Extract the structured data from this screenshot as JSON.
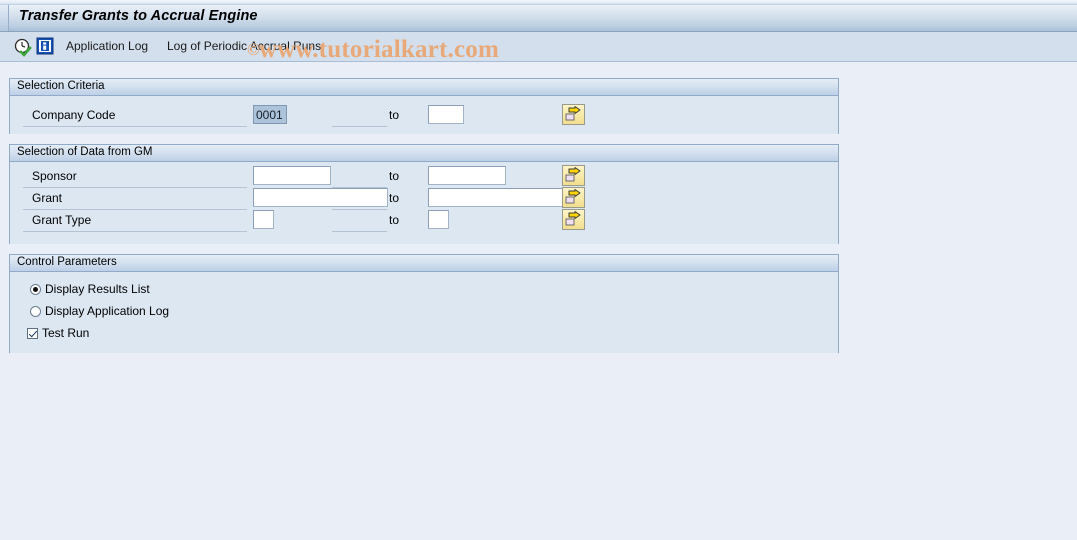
{
  "window": {
    "title": "Transfer Grants to Accrual Engine"
  },
  "toolbar": {
    "execute_icon": "clock-check-icon",
    "info_icon": "info-icon",
    "application_log_label": "Application Log",
    "periodic_log_label": "Log of Periodic Accrual Runs"
  },
  "watermark": {
    "copyright": "©",
    "text": "www.tutorialkart.com",
    "color": "#e8a877"
  },
  "panels": {
    "selection_criteria": {
      "title": "Selection Criteria",
      "rows": [
        {
          "label": "Company Code",
          "from_value": "0001",
          "from_placeholder": "",
          "to_label": "to",
          "to_value": "",
          "to_placeholder": "",
          "multi_select_icon": "multi-select-arrow-icon"
        }
      ]
    },
    "selection_of_data_from_gm": {
      "title": "Selection of Data from GM",
      "rows": [
        {
          "label": "Sponsor",
          "from_value": "",
          "from_placeholder": "",
          "to_label": "to",
          "to_value": "",
          "to_placeholder": "",
          "multi_select_icon": "multi-select-arrow-icon"
        },
        {
          "label": "Grant",
          "from_value": "",
          "from_placeholder": "",
          "to_label": "to",
          "to_value": "",
          "to_placeholder": "",
          "multi_select_icon": "multi-select-arrow-icon"
        },
        {
          "label": "Grant Type",
          "from_value": "",
          "from_placeholder": "",
          "to_label": "to",
          "to_value": "",
          "to_placeholder": "",
          "multi_select_icon": "multi-select-arrow-icon"
        }
      ]
    },
    "control_parameters": {
      "title": "Control Parameters",
      "options": [
        {
          "type": "radio",
          "label": "Display Results List",
          "selected": true
        },
        {
          "type": "radio",
          "label": "Display Application Log",
          "selected": false
        },
        {
          "type": "checkbox",
          "label": "Test Run",
          "selected": true
        }
      ]
    }
  },
  "colors": {
    "page_background": "#eaeff7",
    "panel_background": "#dde7f2",
    "panel_border": "#8fabc8",
    "toolbar_background": "#d3dfec",
    "selected_field_background": "#adc3da",
    "multi_select_button": "#f7e9a8"
  }
}
